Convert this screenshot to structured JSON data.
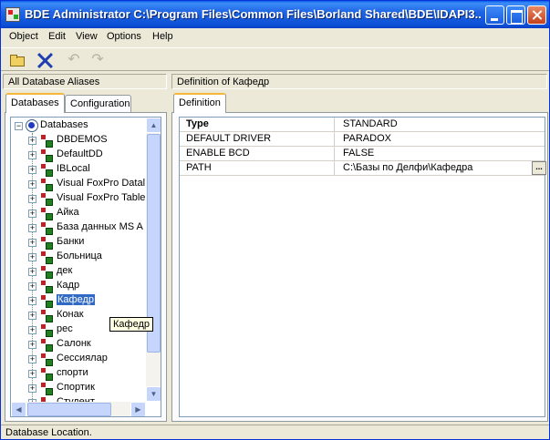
{
  "window": {
    "title": "BDE Administrator  C:\\Program Files\\Common Files\\Borland Shared\\BDE\\IDAPI3..."
  },
  "menu": [
    "Object",
    "Edit",
    "View",
    "Options",
    "Help"
  ],
  "toolbar": {
    "icons": [
      "open-icon",
      "delete-icon",
      "undo-icon",
      "redo-icon"
    ]
  },
  "left_panel": {
    "header": "All Database Aliases",
    "tabs": [
      "Databases",
      "Configuration"
    ],
    "root_label": "Databases",
    "items": [
      "DBDEMOS",
      "DefaultDD",
      "IBLocal",
      "Visual FoxPro Datal",
      "Visual FoxPro Table",
      "Айка",
      "База данных MS A",
      "Банки",
      "Больница",
      "дек",
      "Кадр",
      "Кафедр",
      "Конак",
      "рес",
      "Салонк",
      "Сессиялар",
      "спорти",
      "Спортик",
      "Студент"
    ],
    "selected": "Кафедр",
    "tooltip": "Кафедр"
  },
  "right_panel": {
    "header": "Definition of Кафедр",
    "tab": "Definition",
    "rows": [
      {
        "key": "Type",
        "value": "STANDARD"
      },
      {
        "key": "DEFAULT DRIVER",
        "value": "PARADOX"
      },
      {
        "key": "ENABLE BCD",
        "value": "FALSE"
      },
      {
        "key": "PATH",
        "value": "C:\\Базы по Делфи\\Кафедра"
      }
    ],
    "ellipsis": "..."
  },
  "status": "Database Location."
}
